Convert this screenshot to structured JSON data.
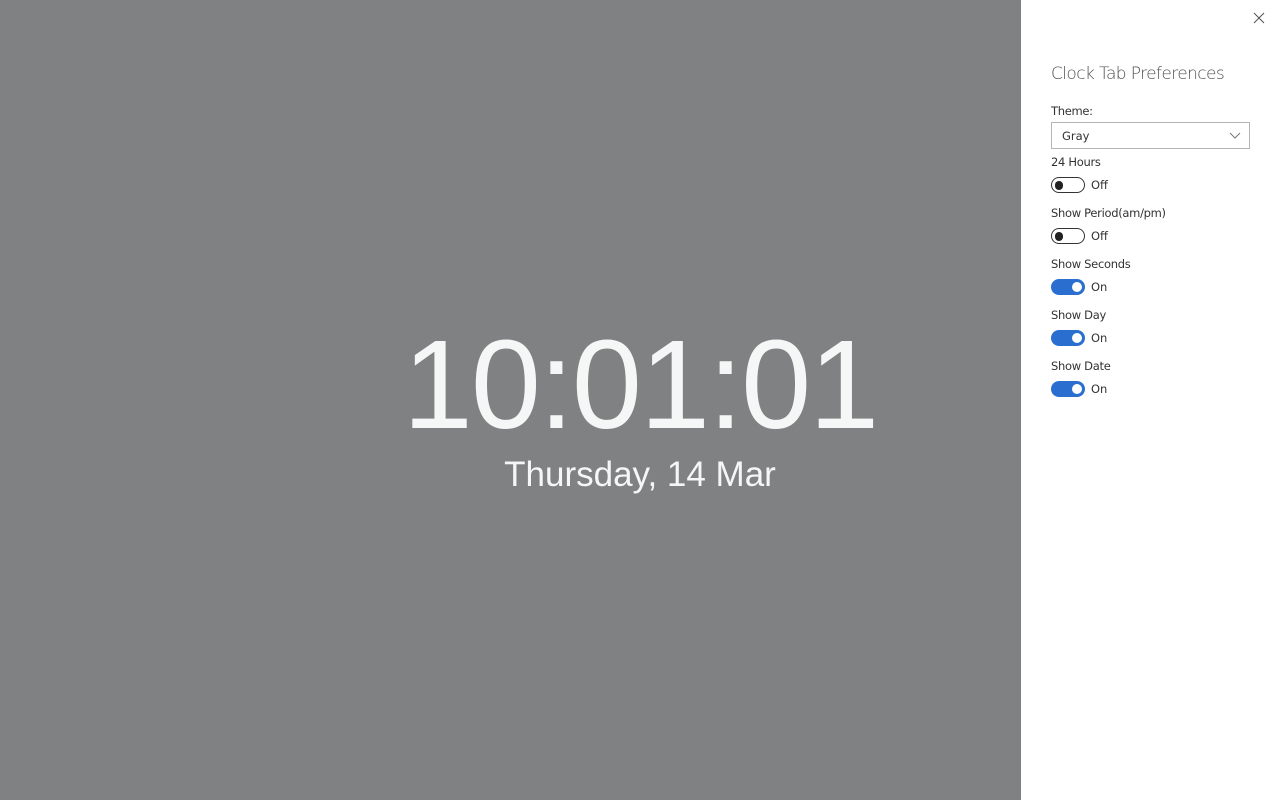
{
  "clock": {
    "time": "10:01:01",
    "date": "Thursday, 14 Mar"
  },
  "panel": {
    "title": "Clock Tab Preferences",
    "close_icon": "close-icon",
    "theme": {
      "label": "Theme:",
      "selected": "Gray"
    },
    "settings": [
      {
        "label": "24 Hours",
        "state": "Off",
        "on": false
      },
      {
        "label": "Show Period(am/pm)",
        "state": "Off",
        "on": false
      },
      {
        "label": "Show Seconds",
        "state": "On",
        "on": true
      },
      {
        "label": "Show Day",
        "state": "On",
        "on": true
      },
      {
        "label": "Show Date",
        "state": "On",
        "on": true
      }
    ]
  },
  "colors": {
    "background": "#808183",
    "accent": "#2a6fcf",
    "panel": "#ffffff",
    "clock_text": "#f5f6f6"
  }
}
